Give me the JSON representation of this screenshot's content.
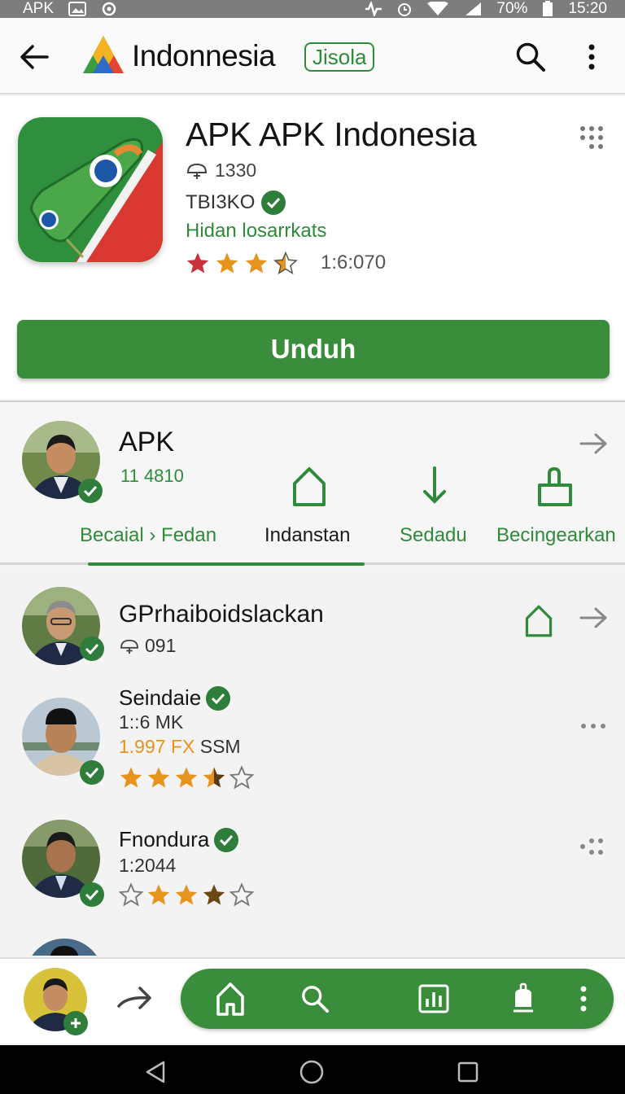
{
  "status_bar": {
    "left_label": "APK",
    "battery": "70%",
    "time": "15:20"
  },
  "app_bar": {
    "brand_name": "Indonnesia",
    "brand_tag": "Jisola",
    "icons": [
      "back-arrow-icon",
      "search-icon",
      "kebab-menu-icon"
    ]
  },
  "app": {
    "title": "APK APK Indonesia",
    "downloads": "1330",
    "developer": "TBI3KO",
    "category": "Hidan losarrkats",
    "rating": 3.5,
    "rating_text": "1:6:070",
    "download_label": "Unduh"
  },
  "feature": {
    "title": "APK",
    "count": "11 4810",
    "labels": [
      "Becaial › Fedan",
      "Indanstan",
      "Sedadu",
      "Becingearkan"
    ]
  },
  "list": {
    "items": [
      {
        "name": "GPrhaiboidslackan",
        "sub": "091"
      },
      {
        "name": "Seindaie",
        "sub": "1::6 MK",
        "highlight": "1.997 FX",
        "highlight_suffix": "SSM",
        "rating": 3.5
      },
      {
        "name": "Fnondura",
        "sub": "1:2044",
        "rating": 3.0
      }
    ]
  },
  "colors": {
    "accent_green": "#3a8d3b",
    "text_green": "#2f8a3a",
    "star_orange": "#e6941e",
    "star_red": "#c8323a"
  }
}
